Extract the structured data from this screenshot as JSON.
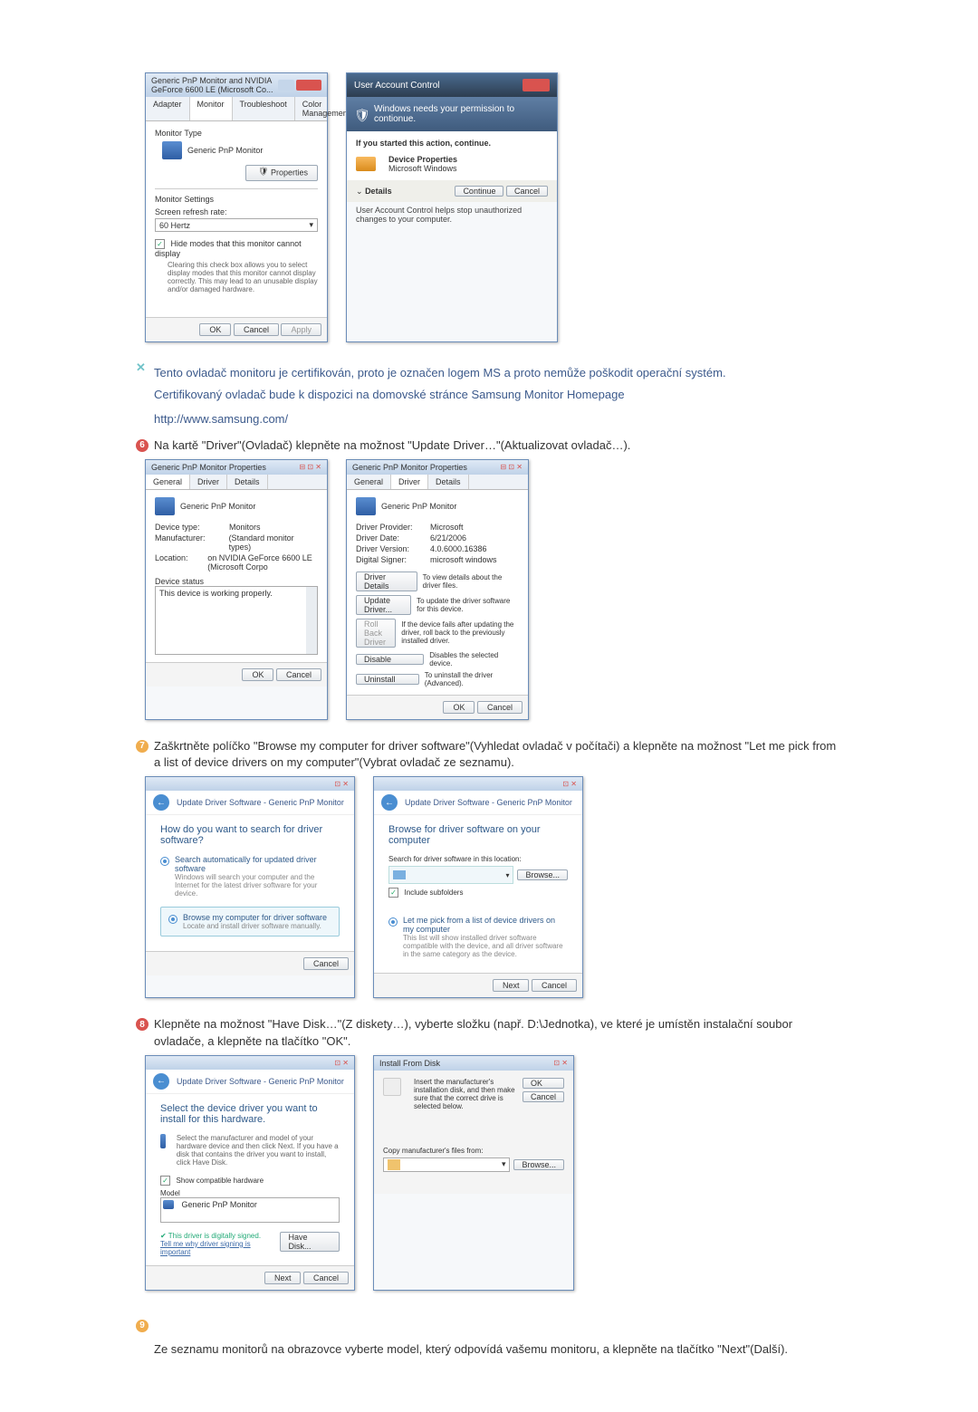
{
  "d1_title": "Generic PnP Monitor and NVIDIA GeForce 6600 LE (Microsoft Co...",
  "d1_tabs": {
    "adapter": "Adapter",
    "monitor": "Monitor",
    "troubleshoot": "Troubleshoot",
    "color": "Color Management"
  },
  "d1": {
    "monitor_type": "Monitor Type",
    "monitor_name": "Generic PnP Monitor",
    "properties_btn": "Properties",
    "monitor_settings": "Monitor Settings",
    "refresh_label": "Screen refresh rate:",
    "refresh_value": "60 Hertz",
    "hide_modes": "Hide modes that this monitor cannot display",
    "hide_note": "Clearing this check box allows you to select display modes that this monitor cannot display correctly. This may lead to an unusable display and/or damaged hardware.",
    "ok": "OK",
    "cancel": "Cancel",
    "apply": "Apply"
  },
  "uac": {
    "title": "User Account Control",
    "headline": "Windows needs your permission to contionue.",
    "started": "If you started this action, continue.",
    "devprop": "Device Properties",
    "mswin": "Microsoft Windows",
    "details": "Details",
    "continue": "Continue",
    "cancel": "Cancel",
    "footer": "User Account Control helps stop unauthorized changes to your computer."
  },
  "note_cert": "Tento ovladač monitoru je certifikován, proto je označen logem MS a proto nemůže poškodit operační systém.",
  "note_cert2": "Certifikovaný ovladač bude k dispozici na domovské stránce Samsung Monitor Homepage",
  "samsung_url": "http://www.samsung.com/",
  "step6_text": "Na kartě \"Driver\"(Ovladač) klepněte na možnost \"Update Driver…\"(Aktualizovat ovladač…).",
  "prop": {
    "title": "Generic PnP Monitor Properties",
    "tabs": {
      "general": "General",
      "driver": "Driver",
      "details": "Details"
    },
    "name": "Generic PnP Monitor",
    "devtype_k": "Device type:",
    "devtype_v": "Monitors",
    "manuf_k": "Manufacturer:",
    "manuf_v": "(Standard monitor types)",
    "loc_k": "Location:",
    "loc_v": "on NVIDIA GeForce 6600 LE (Microsoft Corpo",
    "status_k": "Device status",
    "status_v": "This device is working properly.",
    "ok": "OK",
    "cancel": "Cancel"
  },
  "prop2": {
    "provider_k": "Driver Provider:",
    "provider_v": "Microsoft",
    "date_k": "Driver Date:",
    "date_v": "6/21/2006",
    "ver_k": "Driver Version:",
    "ver_v": "4.0.6000.16386",
    "sign_k": "Digital Signer:",
    "sign_v": "microsoft windows",
    "details_btn": "Driver Details",
    "details_txt": "To view details about the driver files.",
    "update_btn": "Update Driver...",
    "update_txt": "To update the driver software for this device.",
    "rollback_btn": "Roll Back Driver",
    "rollback_txt": "If the device fails after updating the driver, roll back to the previously installed driver.",
    "disable_btn": "Disable",
    "disable_txt": "Disables the selected device.",
    "uninstall_btn": "Uninstall",
    "uninstall_txt": "To uninstall the driver (Advanced)."
  },
  "step7_text": "Zaškrtněte políčko \"Browse my computer for driver software\"(Vyhledat ovladač v počítači) a klepněte na možnost \"Let me pick from a list of device drivers on my computer\"(Vybrat ovladač ze seznamu).",
  "wiz": {
    "header": "Update Driver Software - Generic PnP Monitor",
    "q": "How do you want to search for driver software?",
    "opt1_t": "Search automatically for updated driver software",
    "opt1_d": "Windows will search your computer and the Internet for the latest driver software for your device.",
    "opt2_t": "Browse my computer for driver software",
    "opt2_d": "Locate and install driver software manually.",
    "cancel": "Cancel"
  },
  "wiz2": {
    "title": "Browse for driver software on your computer",
    "search_label": "Search for driver software in this location:",
    "browse": "Browse...",
    "include": "Include subfolders",
    "pick_t": "Let me pick from a list of device drivers on my computer",
    "pick_d": "This list will show installed driver software compatible with the device, and all driver software in the same category as the device.",
    "next": "Next",
    "cancel": "Cancel"
  },
  "step8_text": "Klepněte na možnost \"Have Disk…\"(Z diskety…), vyberte složku (např. D:\\Jednotka), ve které je umístěn instalační soubor ovladače, a klepněte na tlačítko \"OK\".",
  "wiz3": {
    "title": "Select the device driver you want to install for this hardware.",
    "hint": "Select the manufacturer and model of your hardware device and then click Next. If you have a disk that contains the driver you want to install, click Have Disk.",
    "compat": "Show compatible hardware",
    "model": "Model",
    "model_item": "Generic PnP Monitor",
    "signed": "This driver is digitally signed.",
    "tell": "Tell me why driver signing is important",
    "have_disk": "Have Disk...",
    "next": "Next",
    "cancel": "Cancel"
  },
  "ifd": {
    "title": "Install From Disk",
    "msg": "Insert the manufacturer's installation disk, and then make sure that the correct drive is selected below.",
    "ok": "OK",
    "cancel": "Cancel",
    "copy": "Copy manufacturer's files from:",
    "browse": "Browse..."
  },
  "step9_text": "Ze seznamu monitorů na obrazovce vyberte model, který odpovídá vašemu monitoru, a klepněte na tlačítko \"Next\"(Další)."
}
